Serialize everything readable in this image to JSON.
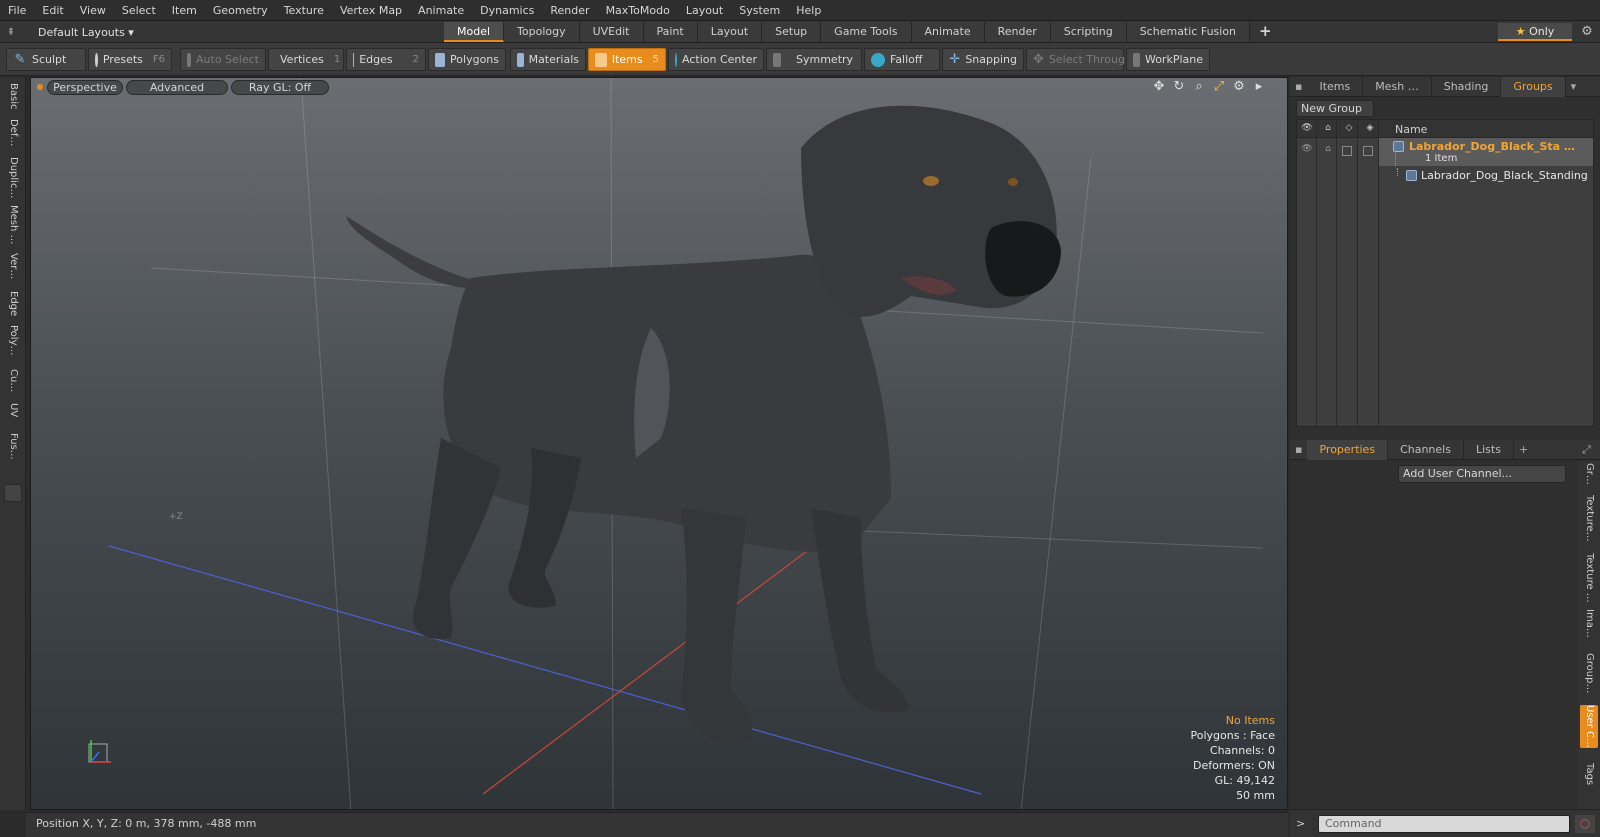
{
  "menu": [
    "File",
    "Edit",
    "View",
    "Select",
    "Item",
    "Geometry",
    "Texture",
    "Vertex Map",
    "Animate",
    "Dynamics",
    "Render",
    "MaxToModo",
    "Layout",
    "System",
    "Help"
  ],
  "layout": {
    "dropdown": "Default Layouts ▾"
  },
  "tabs": [
    "Model",
    "Topology",
    "UVEdit",
    "Paint",
    "Layout",
    "Setup",
    "Game Tools",
    "Animate",
    "Render",
    "Scripting",
    "Schematic Fusion"
  ],
  "only_label": "Only",
  "toolbar": {
    "sculpt": "Sculpt",
    "presets": "Presets",
    "presets_key": "F6",
    "auto_select": "Auto Select",
    "vertices": "Vertices",
    "vertices_key": "1",
    "edges": "Edges",
    "edges_key": "2",
    "polygons": "Polygons",
    "materials": "Materials",
    "items": "Items",
    "items_key": "5",
    "action_center": "Action Center",
    "symmetry": "Symmetry",
    "falloff": "Falloff",
    "snapping": "Snapping",
    "select_through": "Select Through",
    "workplane": "WorkPlane"
  },
  "left_tabs": [
    "Basic",
    "Def…",
    "Duplic…",
    "Mesh …",
    "Ver…",
    "Edge",
    "Poly…",
    "Cu…",
    "UV",
    "Fus…"
  ],
  "viewport": {
    "view": "Perspective",
    "shading": "Advanced",
    "raygl": "Ray GL: Off",
    "axis_label": "+Z",
    "stats": {
      "selection": "No Items",
      "polygons": "Polygons : Face",
      "channels": "Channels: 0",
      "deformers": "Deformers: ON",
      "gl": "GL: 49,142",
      "size": "50 mm"
    }
  },
  "status": "Position X, Y, Z:   0 m, 378 mm, -488 mm",
  "right_tabs": [
    "Items",
    "Mesh …",
    "Shading",
    "Groups"
  ],
  "groups": {
    "new_group": "New Group",
    "name_col": "Name",
    "group_name": "Labrador_Dog_Black_Sta …",
    "group_count": "1 Item",
    "item_name": "Labrador_Dog_Black_Standing"
  },
  "prop_tabs": [
    "Properties",
    "Channels",
    "Lists"
  ],
  "add_user_channel": "Add User Channel...",
  "right_vtabs": [
    "Gr…",
    "Texture…",
    "Texture …",
    "Ima…",
    "Group…",
    "User C…",
    "Tags"
  ],
  "command_placeholder": "Command",
  "colors": {
    "accent": "#e88c1e",
    "highlight_text": "#f2a533",
    "dog": "#3a3b3d"
  }
}
